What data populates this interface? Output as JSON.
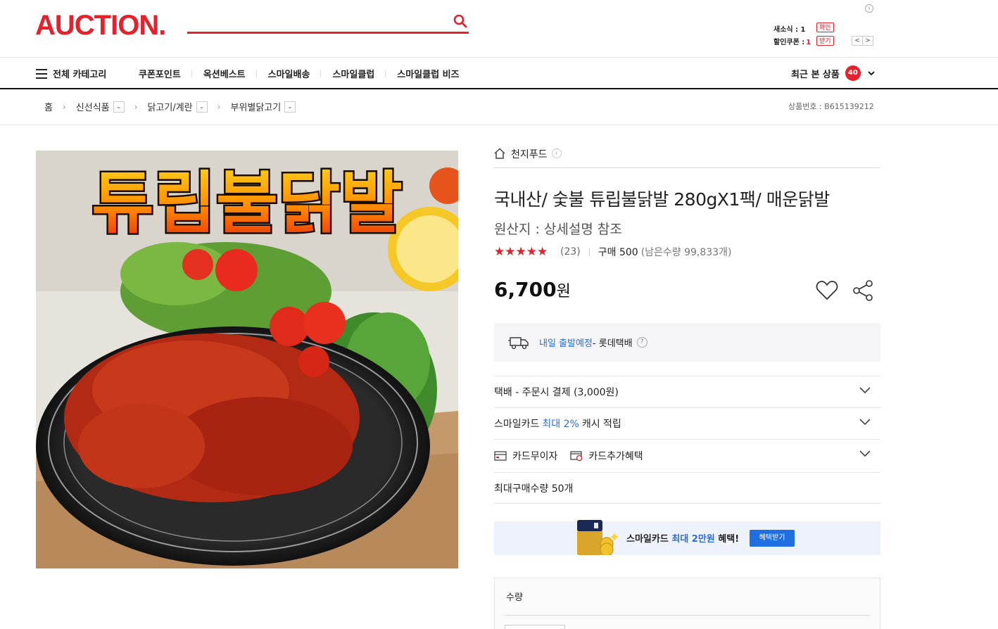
{
  "header": {
    "logo": "AUCTION.",
    "search_placeholder": "",
    "news_label": "새소식 : 1",
    "news_button": "확인",
    "coupon_label": "할인쿠폰 :",
    "coupon_count": "1",
    "coupon_button": "받기",
    "info_glyph": "i",
    "pager_prev": "<",
    "pager_next": ">"
  },
  "nav": {
    "all_categories": "전체 카테고리",
    "items": [
      "쿠폰포인트",
      "옥션베스트",
      "스마일배송",
      "스마일클럽",
      "스마일클럽 비즈"
    ],
    "recent_label": "최근 본 상품",
    "recent_count": "40"
  },
  "breadcrumb": {
    "items": [
      "홈",
      "신선식품",
      "닭고기/계란",
      "부위별닭고기"
    ],
    "product_no": "상품번호 : B615139212"
  },
  "product": {
    "image_text": "튜립불닭발",
    "seller": "천지푸드",
    "title": "국내산/ 숯불 튜립불닭발 280gX1팩/ 매운닭발",
    "origin": "원산지 : 상세설명 참조",
    "rating": 4.5,
    "review_count": "(23)",
    "sales": "구매 500",
    "stock": "(남은수량 99,833개)",
    "price": "6,700",
    "price_unit": "원"
  },
  "delivery": {
    "link": "내일 출발예정",
    "carrier": " - 롯데택배",
    "help": "?"
  },
  "options": {
    "shipping": "택배 - 주문시 결제 (3,000원)",
    "smile_card_prefix": "스마일카드 ",
    "smile_card_highlight": "최대 2%",
    "smile_card_suffix": " 캐시 적립",
    "card_free": "카드무이자",
    "card_extra": "카드추가혜택",
    "max_qty": "최대구매수량 50개"
  },
  "benefit": {
    "prefix": "스마일카드 ",
    "highlight": "최대 2만원",
    "suffix": " 혜택!",
    "button": "혜택받기"
  },
  "quantity": {
    "label": "수량"
  },
  "colors": {
    "brand": "#e5212b",
    "link": "#2e6ed4",
    "button": "#1f6fe0"
  }
}
